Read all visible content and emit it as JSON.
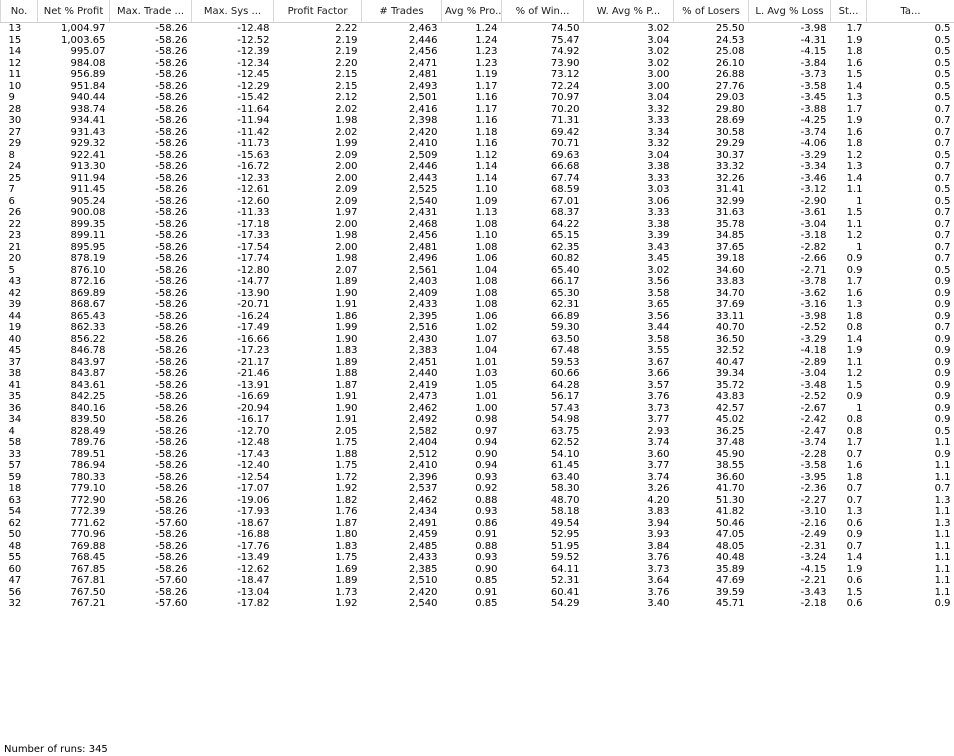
{
  "columns": [
    "No.",
    "Net % Profit",
    "Max. Trade ...",
    "Max. Sys ...",
    "Profit Factor",
    "# Trades",
    "Avg % Pro...",
    "% of Win...",
    "W. Avg % P...",
    "% of Losers",
    "L. Avg % Loss",
    "St...",
    "Ta..."
  ],
  "rows": [
    [
      "13",
      "1,004.97",
      "-58.26",
      "-12.48",
      "2.22",
      "2,463",
      "1.24",
      "74.50",
      "3.02",
      "25.50",
      "-3.98",
      "1.7",
      "0.5"
    ],
    [
      "15",
      "1,003.65",
      "-58.26",
      "-12.52",
      "2.19",
      "2,446",
      "1.24",
      "75.47",
      "3.04",
      "24.53",
      "-4.31",
      "1.9",
      "0.5"
    ],
    [
      "14",
      "995.07",
      "-58.26",
      "-12.39",
      "2.19",
      "2,456",
      "1.23",
      "74.92",
      "3.02",
      "25.08",
      "-4.15",
      "1.8",
      "0.5"
    ],
    [
      "12",
      "984.08",
      "-58.26",
      "-12.34",
      "2.20",
      "2,471",
      "1.23",
      "73.90",
      "3.02",
      "26.10",
      "-3.84",
      "1.6",
      "0.5"
    ],
    [
      "11",
      "956.89",
      "-58.26",
      "-12.45",
      "2.15",
      "2,481",
      "1.19",
      "73.12",
      "3.00",
      "26.88",
      "-3.73",
      "1.5",
      "0.5"
    ],
    [
      "10",
      "951.84",
      "-58.26",
      "-12.29",
      "2.15",
      "2,493",
      "1.17",
      "72.24",
      "3.00",
      "27.76",
      "-3.58",
      "1.4",
      "0.5"
    ],
    [
      "9",
      "940.44",
      "-58.26",
      "-15.42",
      "2.12",
      "2,501",
      "1.16",
      "70.97",
      "3.04",
      "29.03",
      "-3.45",
      "1.3",
      "0.5"
    ],
    [
      "28",
      "938.74",
      "-58.26",
      "-11.64",
      "2.02",
      "2,416",
      "1.17",
      "70.20",
      "3.32",
      "29.80",
      "-3.88",
      "1.7",
      "0.7"
    ],
    [
      "30",
      "934.41",
      "-58.26",
      "-11.94",
      "1.98",
      "2,398",
      "1.16",
      "71.31",
      "3.33",
      "28.69",
      "-4.25",
      "1.9",
      "0.7"
    ],
    [
      "27",
      "931.43",
      "-58.26",
      "-11.42",
      "2.02",
      "2,420",
      "1.18",
      "69.42",
      "3.34",
      "30.58",
      "-3.74",
      "1.6",
      "0.7"
    ],
    [
      "29",
      "929.32",
      "-58.26",
      "-11.73",
      "1.99",
      "2,410",
      "1.16",
      "70.71",
      "3.32",
      "29.29",
      "-4.06",
      "1.8",
      "0.7"
    ],
    [
      "8",
      "922.41",
      "-58.26",
      "-15.63",
      "2.09",
      "2,509",
      "1.12",
      "69.63",
      "3.04",
      "30.37",
      "-3.29",
      "1.2",
      "0.5"
    ],
    [
      "24",
      "913.30",
      "-58.26",
      "-16.72",
      "2.00",
      "2,446",
      "1.14",
      "66.68",
      "3.38",
      "33.32",
      "-3.34",
      "1.3",
      "0.7"
    ],
    [
      "25",
      "911.94",
      "-58.26",
      "-12.33",
      "2.00",
      "2,443",
      "1.14",
      "67.74",
      "3.33",
      "32.26",
      "-3.46",
      "1.4",
      "0.7"
    ],
    [
      "7",
      "911.45",
      "-58.26",
      "-12.61",
      "2.09",
      "2,525",
      "1.10",
      "68.59",
      "3.03",
      "31.41",
      "-3.12",
      "1.1",
      "0.5"
    ],
    [
      "6",
      "905.24",
      "-58.26",
      "-12.60",
      "2.09",
      "2,540",
      "1.09",
      "67.01",
      "3.06",
      "32.99",
      "-2.90",
      "1",
      "0.5"
    ],
    [
      "26",
      "900.08",
      "-58.26",
      "-11.33",
      "1.97",
      "2,431",
      "1.13",
      "68.37",
      "3.33",
      "31.63",
      "-3.61",
      "1.5",
      "0.7"
    ],
    [
      "22",
      "899.35",
      "-58.26",
      "-17.18",
      "2.00",
      "2,468",
      "1.08",
      "64.22",
      "3.38",
      "35.78",
      "-3.04",
      "1.1",
      "0.7"
    ],
    [
      "23",
      "899.11",
      "-58.26",
      "-17.33",
      "1.98",
      "2,456",
      "1.10",
      "65.15",
      "3.39",
      "34.85",
      "-3.18",
      "1.2",
      "0.7"
    ],
    [
      "21",
      "895.95",
      "-58.26",
      "-17.54",
      "2.00",
      "2,481",
      "1.08",
      "62.35",
      "3.43",
      "37.65",
      "-2.82",
      "1",
      "0.7"
    ],
    [
      "20",
      "878.19",
      "-58.26",
      "-17.74",
      "1.98",
      "2,496",
      "1.06",
      "60.82",
      "3.45",
      "39.18",
      "-2.66",
      "0.9",
      "0.7"
    ],
    [
      "5",
      "876.10",
      "-58.26",
      "-12.80",
      "2.07",
      "2,561",
      "1.04",
      "65.40",
      "3.02",
      "34.60",
      "-2.71",
      "0.9",
      "0.5"
    ],
    [
      "43",
      "872.16",
      "-58.26",
      "-14.77",
      "1.89",
      "2,403",
      "1.08",
      "66.17",
      "3.56",
      "33.83",
      "-3.78",
      "1.7",
      "0.9"
    ],
    [
      "42",
      "869.89",
      "-58.26",
      "-13.90",
      "1.90",
      "2,409",
      "1.08",
      "65.30",
      "3.58",
      "34.70",
      "-3.62",
      "1.6",
      "0.9"
    ],
    [
      "39",
      "868.67",
      "-58.26",
      "-20.71",
      "1.91",
      "2,433",
      "1.08",
      "62.31",
      "3.65",
      "37.69",
      "-3.16",
      "1.3",
      "0.9"
    ],
    [
      "44",
      "865.43",
      "-58.26",
      "-16.24",
      "1.86",
      "2,395",
      "1.06",
      "66.89",
      "3.56",
      "33.11",
      "-3.98",
      "1.8",
      "0.9"
    ],
    [
      "19",
      "862.33",
      "-58.26",
      "-17.49",
      "1.99",
      "2,516",
      "1.02",
      "59.30",
      "3.44",
      "40.70",
      "-2.52",
      "0.8",
      "0.7"
    ],
    [
      "40",
      "856.22",
      "-58.26",
      "-16.66",
      "1.90",
      "2,430",
      "1.07",
      "63.50",
      "3.58",
      "36.50",
      "-3.29",
      "1.4",
      "0.9"
    ],
    [
      "45",
      "846.78",
      "-58.26",
      "-17.23",
      "1.83",
      "2,383",
      "1.04",
      "67.48",
      "3.55",
      "32.52",
      "-4.18",
      "1.9",
      "0.9"
    ],
    [
      "37",
      "843.97",
      "-58.26",
      "-21.17",
      "1.89",
      "2,451",
      "1.01",
      "59.53",
      "3.67",
      "40.47",
      "-2.89",
      "1.1",
      "0.9"
    ],
    [
      "38",
      "843.87",
      "-58.26",
      "-21.46",
      "1.88",
      "2,440",
      "1.03",
      "60.66",
      "3.66",
      "39.34",
      "-3.04",
      "1.2",
      "0.9"
    ],
    [
      "41",
      "843.61",
      "-58.26",
      "-13.91",
      "1.87",
      "2,419",
      "1.05",
      "64.28",
      "3.57",
      "35.72",
      "-3.48",
      "1.5",
      "0.9"
    ],
    [
      "35",
      "842.25",
      "-58.26",
      "-16.69",
      "1.91",
      "2,473",
      "1.01",
      "56.17",
      "3.76",
      "43.83",
      "-2.52",
      "0.9",
      "0.9"
    ],
    [
      "36",
      "840.16",
      "-58.26",
      "-20.94",
      "1.90",
      "2,462",
      "1.00",
      "57.43",
      "3.73",
      "42.57",
      "-2.67",
      "1",
      "0.9"
    ],
    [
      "34",
      "839.50",
      "-58.26",
      "-16.17",
      "1.91",
      "2,492",
      "0.98",
      "54.98",
      "3.77",
      "45.02",
      "-2.42",
      "0.8",
      "0.9"
    ],
    [
      "4",
      "828.49",
      "-58.26",
      "-12.70",
      "2.05",
      "2,582",
      "0.97",
      "63.75",
      "2.93",
      "36.25",
      "-2.47",
      "0.8",
      "0.5"
    ],
    [
      "58",
      "789.76",
      "-58.26",
      "-12.48",
      "1.75",
      "2,404",
      "0.94",
      "62.52",
      "3.74",
      "37.48",
      "-3.74",
      "1.7",
      "1.1"
    ],
    [
      "33",
      "789.51",
      "-58.26",
      "-17.43",
      "1.88",
      "2,512",
      "0.90",
      "54.10",
      "3.60",
      "45.90",
      "-2.28",
      "0.7",
      "0.9"
    ],
    [
      "57",
      "786.94",
      "-58.26",
      "-12.40",
      "1.75",
      "2,410",
      "0.94",
      "61.45",
      "3.77",
      "38.55",
      "-3.58",
      "1.6",
      "1.1"
    ],
    [
      "59",
      "780.33",
      "-58.26",
      "-12.54",
      "1.72",
      "2,396",
      "0.93",
      "63.40",
      "3.74",
      "36.60",
      "-3.95",
      "1.8",
      "1.1"
    ],
    [
      "18",
      "779.10",
      "-58.26",
      "-17.07",
      "1.92",
      "2,537",
      "0.92",
      "58.30",
      "3.26",
      "41.70",
      "-2.36",
      "0.7",
      "0.7"
    ],
    [
      "63",
      "772.90",
      "-58.26",
      "-19.06",
      "1.82",
      "2,462",
      "0.88",
      "48.70",
      "4.20",
      "51.30",
      "-2.27",
      "0.7",
      "1.3"
    ],
    [
      "54",
      "772.39",
      "-58.26",
      "-17.93",
      "1.76",
      "2,434",
      "0.93",
      "58.18",
      "3.83",
      "41.82",
      "-3.10",
      "1.3",
      "1.1"
    ],
    [
      "62",
      "771.62",
      "-57.60",
      "-18.67",
      "1.87",
      "2,491",
      "0.86",
      "49.54",
      "3.94",
      "50.46",
      "-2.16",
      "0.6",
      "1.3"
    ],
    [
      "50",
      "770.96",
      "-58.26",
      "-16.88",
      "1.80",
      "2,459",
      "0.91",
      "52.95",
      "3.93",
      "47.05",
      "-2.49",
      "0.9",
      "1.1"
    ],
    [
      "48",
      "769.88",
      "-58.26",
      "-17.76",
      "1.83",
      "2,485",
      "0.88",
      "51.95",
      "3.84",
      "48.05",
      "-2.31",
      "0.7",
      "1.1"
    ],
    [
      "55",
      "768.45",
      "-58.26",
      "-13.49",
      "1.75",
      "2,433",
      "0.93",
      "59.52",
      "3.76",
      "40.48",
      "-3.24",
      "1.4",
      "1.1"
    ],
    [
      "60",
      "767.85",
      "-58.26",
      "-12.62",
      "1.69",
      "2,385",
      "0.90",
      "64.11",
      "3.73",
      "35.89",
      "-4.15",
      "1.9",
      "1.1"
    ],
    [
      "47",
      "767.81",
      "-57.60",
      "-18.47",
      "1.89",
      "2,510",
      "0.85",
      "52.31",
      "3.64",
      "47.69",
      "-2.21",
      "0.6",
      "1.1"
    ],
    [
      "56",
      "767.50",
      "-58.26",
      "-13.04",
      "1.73",
      "2,420",
      "0.91",
      "60.41",
      "3.76",
      "39.59",
      "-3.43",
      "1.5",
      "1.1"
    ],
    [
      "32",
      "767.21",
      "-57.60",
      "-17.82",
      "1.92",
      "2,540",
      "0.85",
      "54.29",
      "3.40",
      "45.71",
      "-2.18",
      "0.6",
      "0.9"
    ]
  ],
  "status": "Number of runs: 345",
  "colors": {
    "bar": "#f0a030",
    "grid_line": "#d8d8d8"
  }
}
